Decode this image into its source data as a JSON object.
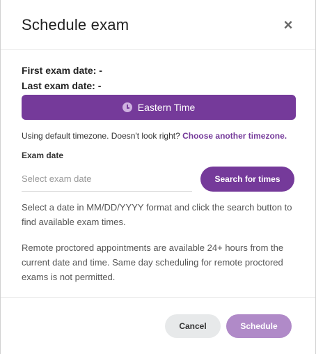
{
  "header": {
    "title": "Schedule exam",
    "close_icon": "×"
  },
  "exam_info": {
    "first_exam_date": "First exam date: -",
    "last_exam_date": "Last exam date: -"
  },
  "timezone": {
    "button_label": "Eastern Time",
    "icon": "clock-icon",
    "note_text": "Using default timezone. Doesn't look right?",
    "note_link": "Choose another timezone."
  },
  "exam_date": {
    "label": "Exam date",
    "input_value": "",
    "placeholder": "Select exam date",
    "search_button": "Search for times"
  },
  "help": {
    "line1": "Select a date in MM/DD/YYYY format and click the search button to find available exam times.",
    "line2": "Remote proctored appointments are available 24+ hours from the current date and time. Same day scheduling for remote proctored exams is not permitted."
  },
  "footer": {
    "cancel": "Cancel",
    "schedule": "Schedule"
  },
  "colors": {
    "primary": "#753a9a",
    "primary_disabled": "#b08ac8",
    "neutral_button": "#e7e9ea"
  }
}
